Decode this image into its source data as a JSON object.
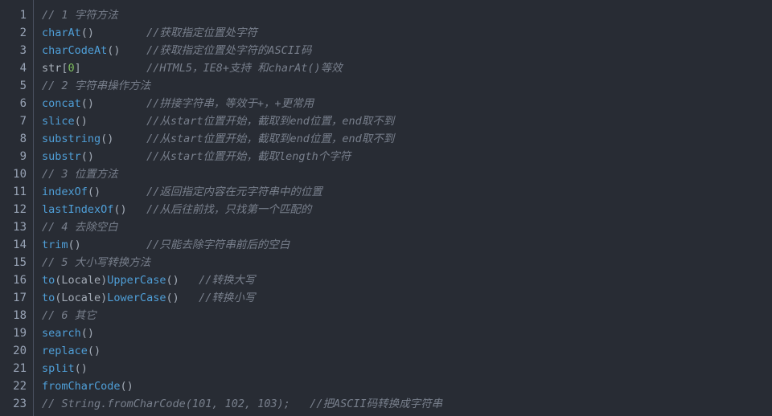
{
  "editor": {
    "title": "code-editor",
    "language": "javascript",
    "theme_background": "#282c34",
    "gutter_separator_color": "#4a5160",
    "colors": {
      "background": "#282c34",
      "line_number": "#98a3b5",
      "function_name": "#4f9fd8",
      "punctuation": "#a3abb6",
      "number_literal": "#7fbf5f",
      "comment": "#787f8c",
      "plain_text": "#a9b1bb"
    },
    "first_line_number": 1,
    "last_line_number": 23,
    "total_lines": 23
  },
  "lines": [
    {
      "num": "1",
      "tokens": [
        {
          "t": "comment",
          "v": "// 1 字符方法"
        }
      ]
    },
    {
      "num": "2",
      "tokens": [
        {
          "t": "fn",
          "v": "charAt"
        },
        {
          "t": "punct",
          "v": "()"
        },
        {
          "t": "plain",
          "v": "        "
        },
        {
          "t": "comment",
          "v": "//获取指定位置处字符"
        }
      ]
    },
    {
      "num": "3",
      "tokens": [
        {
          "t": "fn",
          "v": "charCodeAt"
        },
        {
          "t": "punct",
          "v": "()"
        },
        {
          "t": "plain",
          "v": "    "
        },
        {
          "t": "comment",
          "v": "//获取指定位置处字符的ASCII码"
        }
      ]
    },
    {
      "num": "4",
      "tokens": [
        {
          "t": "plain",
          "v": "str"
        },
        {
          "t": "punct",
          "v": "["
        },
        {
          "t": "num",
          "v": "0"
        },
        {
          "t": "punct",
          "v": "]"
        },
        {
          "t": "plain",
          "v": "          "
        },
        {
          "t": "comment",
          "v": "//HTML5，IE8+支持 和charAt()等效"
        }
      ]
    },
    {
      "num": "5",
      "tokens": [
        {
          "t": "comment",
          "v": "// 2 字符串操作方法"
        }
      ]
    },
    {
      "num": "6",
      "tokens": [
        {
          "t": "fn",
          "v": "concat"
        },
        {
          "t": "punct",
          "v": "()"
        },
        {
          "t": "plain",
          "v": "        "
        },
        {
          "t": "comment",
          "v": "//拼接字符串，等效于+，+更常用"
        }
      ]
    },
    {
      "num": "7",
      "tokens": [
        {
          "t": "fn",
          "v": "slice"
        },
        {
          "t": "punct",
          "v": "()"
        },
        {
          "t": "plain",
          "v": "         "
        },
        {
          "t": "comment",
          "v": "//从start位置开始，截取到end位置，end取不到"
        }
      ]
    },
    {
      "num": "8",
      "tokens": [
        {
          "t": "fn",
          "v": "substring"
        },
        {
          "t": "punct",
          "v": "()"
        },
        {
          "t": "plain",
          "v": "     "
        },
        {
          "t": "comment",
          "v": "//从start位置开始，截取到end位置，end取不到"
        }
      ]
    },
    {
      "num": "9",
      "tokens": [
        {
          "t": "fn",
          "v": "substr"
        },
        {
          "t": "punct",
          "v": "()"
        },
        {
          "t": "plain",
          "v": "        "
        },
        {
          "t": "comment",
          "v": "//从start位置开始，截取length个字符"
        }
      ]
    },
    {
      "num": "10",
      "tokens": [
        {
          "t": "comment",
          "v": "// 3 位置方法"
        }
      ]
    },
    {
      "num": "11",
      "tokens": [
        {
          "t": "fn",
          "v": "indexOf"
        },
        {
          "t": "punct",
          "v": "()"
        },
        {
          "t": "plain",
          "v": "       "
        },
        {
          "t": "comment",
          "v": "//返回指定内容在元字符串中的位置"
        }
      ]
    },
    {
      "num": "12",
      "tokens": [
        {
          "t": "fn",
          "v": "lastIndexOf"
        },
        {
          "t": "punct",
          "v": "()"
        },
        {
          "t": "plain",
          "v": "   "
        },
        {
          "t": "comment",
          "v": "//从后往前找，只找第一个匹配的"
        }
      ]
    },
    {
      "num": "13",
      "tokens": [
        {
          "t": "comment",
          "v": "// 4 去除空白"
        }
      ]
    },
    {
      "num": "14",
      "tokens": [
        {
          "t": "fn",
          "v": "trim"
        },
        {
          "t": "punct",
          "v": "()"
        },
        {
          "t": "plain",
          "v": "          "
        },
        {
          "t": "comment",
          "v": "//只能去除字符串前后的空白"
        }
      ]
    },
    {
      "num": "15",
      "tokens": [
        {
          "t": "comment",
          "v": "// 5 大小写转换方法"
        }
      ]
    },
    {
      "num": "16",
      "tokens": [
        {
          "t": "fn",
          "v": "to"
        },
        {
          "t": "punct",
          "v": "(Locale)"
        },
        {
          "t": "fn",
          "v": "UpperCase"
        },
        {
          "t": "punct",
          "v": "()"
        },
        {
          "t": "plain",
          "v": "   "
        },
        {
          "t": "comment",
          "v": "//转换大写"
        }
      ]
    },
    {
      "num": "17",
      "tokens": [
        {
          "t": "fn",
          "v": "to"
        },
        {
          "t": "punct",
          "v": "(Locale)"
        },
        {
          "t": "fn",
          "v": "LowerCase"
        },
        {
          "t": "punct",
          "v": "()"
        },
        {
          "t": "plain",
          "v": "   "
        },
        {
          "t": "comment",
          "v": "//转换小写"
        }
      ]
    },
    {
      "num": "18",
      "tokens": [
        {
          "t": "comment",
          "v": "// 6 其它"
        }
      ]
    },
    {
      "num": "19",
      "tokens": [
        {
          "t": "fn",
          "v": "search"
        },
        {
          "t": "punct",
          "v": "()"
        }
      ]
    },
    {
      "num": "20",
      "tokens": [
        {
          "t": "fn",
          "v": "replace"
        },
        {
          "t": "punct",
          "v": "()"
        }
      ]
    },
    {
      "num": "21",
      "tokens": [
        {
          "t": "fn",
          "v": "split"
        },
        {
          "t": "punct",
          "v": "()"
        }
      ]
    },
    {
      "num": "22",
      "tokens": [
        {
          "t": "fn",
          "v": "fromCharCode"
        },
        {
          "t": "punct",
          "v": "()"
        }
      ]
    },
    {
      "num": "23",
      "tokens": [
        {
          "t": "comment",
          "v": "// String.fromCharCode(101, 102, 103);   //把ASCII码转换成字符串"
        }
      ]
    }
  ]
}
